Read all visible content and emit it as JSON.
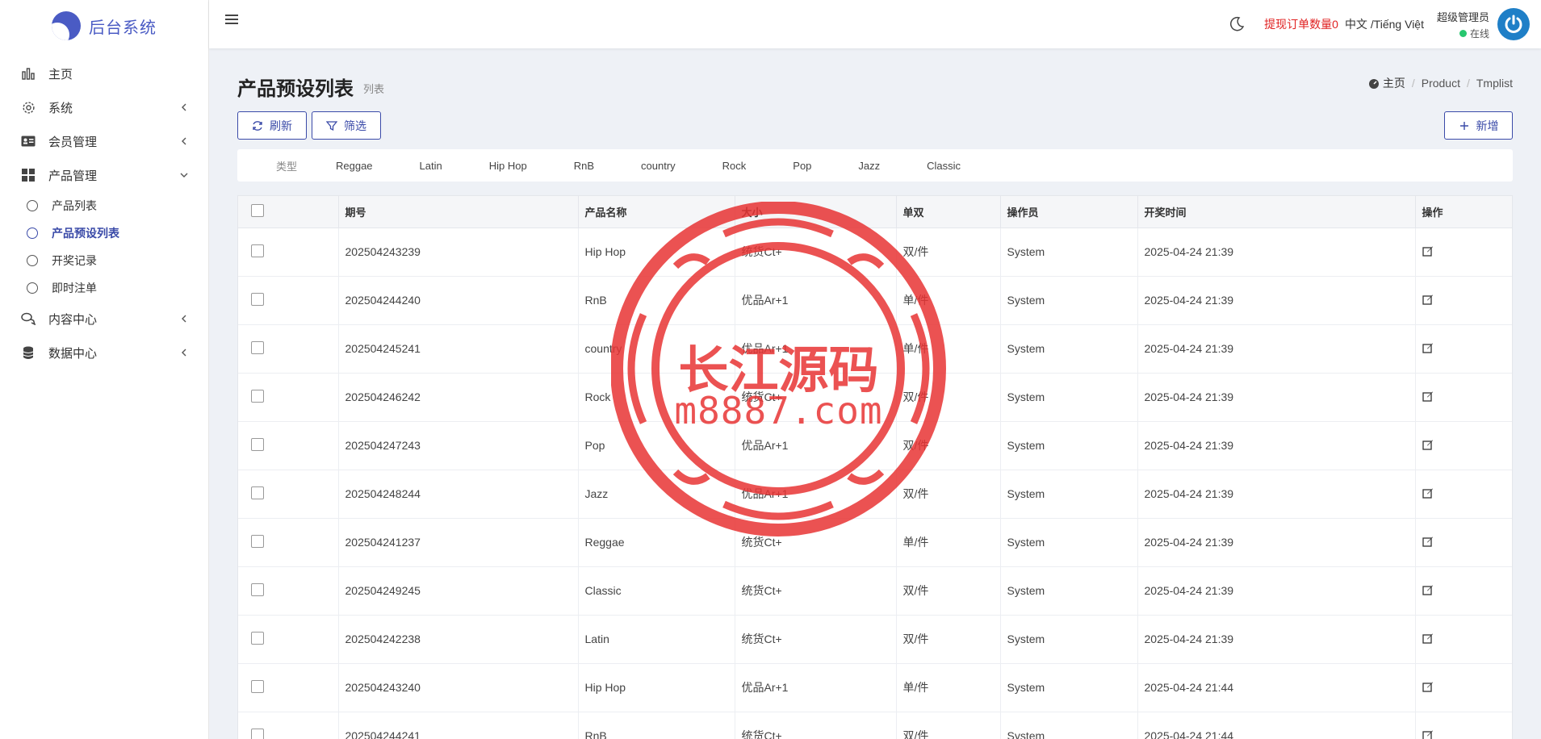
{
  "brand": {
    "title": "后台系统"
  },
  "sidebar": {
    "items": [
      {
        "label": "主页",
        "icon": "bar-chart-icon"
      },
      {
        "label": "系统",
        "icon": "gear-icon"
      },
      {
        "label": "会员管理",
        "icon": "id-card-icon"
      },
      {
        "label": "产品管理",
        "icon": "grid-icon"
      },
      {
        "label": "内容中心",
        "icon": "chat-icon"
      },
      {
        "label": "数据中心",
        "icon": "database-icon"
      }
    ],
    "subitems": [
      {
        "label": "产品列表"
      },
      {
        "label": "产品预设列表"
      },
      {
        "label": "开奖记录"
      },
      {
        "label": "即时注单"
      }
    ]
  },
  "topbar": {
    "order_count": "提现订单数量0",
    "language": "中文 /Tiếng Việt",
    "user_name": "超级管理员",
    "user_status": "在线"
  },
  "page": {
    "title": "产品预设列表",
    "subtitle": "列表",
    "breadcrumb": [
      "主页",
      "Product",
      "Tmplist"
    ]
  },
  "toolbar": {
    "refresh_label": "刷新",
    "filter_label": "筛选",
    "add_label": "新增"
  },
  "filters": {
    "label": "类型",
    "options": [
      "Reggae",
      "Latin",
      "Hip Hop",
      "RnB",
      "country",
      "Rock",
      "Pop",
      "Jazz",
      "Classic"
    ]
  },
  "table": {
    "columns": [
      "期号",
      "产品名称",
      "大小",
      "单双",
      "操作员",
      "开奖时间",
      "操作"
    ],
    "rows": [
      [
        "202504243239",
        "Hip Hop",
        "统货Ct+",
        "双/件",
        "System",
        "2025-04-24 21:39"
      ],
      [
        "202504244240",
        "RnB",
        "优品Ar+1",
        "单/件",
        "System",
        "2025-04-24 21:39"
      ],
      [
        "202504245241",
        "country",
        "优品Ar+1",
        "单/件",
        "System",
        "2025-04-24 21:39"
      ],
      [
        "202504246242",
        "Rock",
        "统货Ct+",
        "双/件",
        "System",
        "2025-04-24 21:39"
      ],
      [
        "202504247243",
        "Pop",
        "优品Ar+1",
        "双/件",
        "System",
        "2025-04-24 21:39"
      ],
      [
        "202504248244",
        "Jazz",
        "优品Ar+1",
        "双/件",
        "System",
        "2025-04-24 21:39"
      ],
      [
        "202504241237",
        "Reggae",
        "统货Ct+",
        "单/件",
        "System",
        "2025-04-24 21:39"
      ],
      [
        "202504249245",
        "Classic",
        "统货Ct+",
        "双/件",
        "System",
        "2025-04-24 21:39"
      ],
      [
        "202504242238",
        "Latin",
        "统货Ct+",
        "双/件",
        "System",
        "2025-04-24 21:39"
      ],
      [
        "202504243240",
        "Hip Hop",
        "优品Ar+1",
        "单/件",
        "System",
        "2025-04-24 21:44"
      ],
      [
        "202504244241",
        "RnB",
        "统货Ct+",
        "双/件",
        "System",
        "2025-04-24 21:44"
      ]
    ]
  },
  "watermark": {
    "line1": "长江源码",
    "line2": "m8887.com"
  },
  "colors": {
    "accent": "#3a4aa8",
    "danger": "#e02020",
    "online": "#28c76f",
    "stamp": "#e83434"
  }
}
